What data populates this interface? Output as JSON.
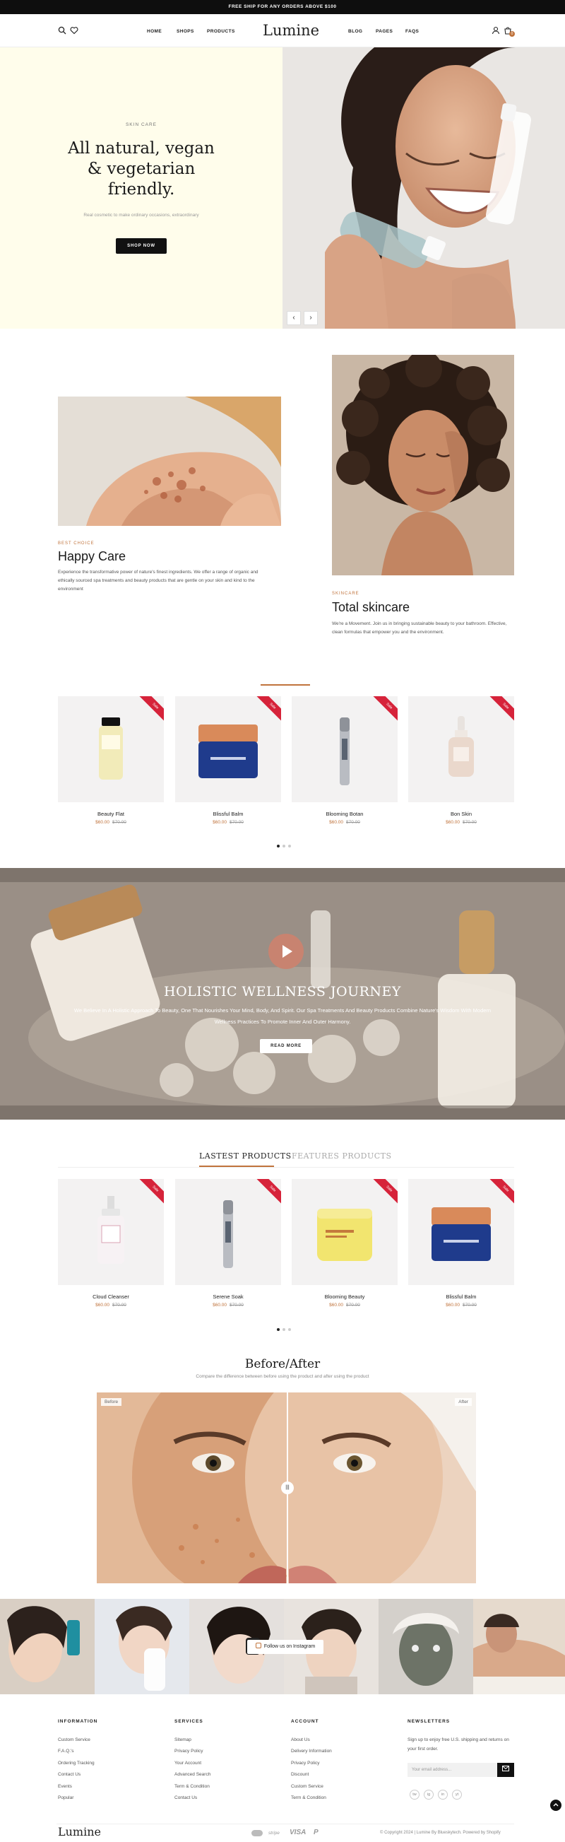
{
  "announcement": "FREE SHIP FOR ANY ORDERS ABOVE $100",
  "header": {
    "logo": "Lumine",
    "nav_left": [
      "HOME",
      "SHOPS",
      "PRODUCTS"
    ],
    "nav_right": [
      "BLOG",
      "PAGES",
      "FAQS"
    ],
    "cart_count": "0"
  },
  "hero": {
    "tag": "SKIN CARE",
    "title": "All natural, vegan & vegetarian friendly.",
    "subtitle": "Real cosmetic to make ordinary occasions, extraordinary",
    "button": "SHOP NOW",
    "prev": "‹",
    "next": "›"
  },
  "collection": {
    "left": {
      "tag": "BEST CHOICE",
      "title": "Happy Care",
      "text": "Experience the transformative power of nature's finest ingredients. We offer a range of organic and ethically sourced spa treatments and beauty products that are gentle on your skin and kind to the environment"
    },
    "right": {
      "tag": "SKINCARE",
      "title": "Total skincare",
      "text": "We're a Movement. Join us in bringing sustainable beauty to your bathroom. Effective, clean formulas that empower you and the environment."
    }
  },
  "products_row1": [
    {
      "name": "Beauty Flat",
      "price": "$60.00",
      "old_price": "$70.00",
      "badge": "Sale"
    },
    {
      "name": "Blissful Balm",
      "price": "$60.00",
      "old_price": "$70.00",
      "badge": "Sale"
    },
    {
      "name": "Blooming Botan",
      "price": "$60.00",
      "old_price": "$70.00",
      "badge": "Sale"
    },
    {
      "name": "Bon Skin",
      "price": "$60.00",
      "old_price": "$70.00",
      "badge": "Sale"
    }
  ],
  "banner": {
    "title": "HOLISTIC WELLNESS JOURNEY",
    "text": "We Believe In A Holistic Approach To Beauty, One That Nourishes Your Mind, Body, And Spirit. Our Spa Treatments And Beauty Products Combine Nature's Wisdom With Modern Wellness Practices To Promote Inner And Outer Harmony.",
    "button": "READ MORE"
  },
  "tabs": {
    "active": "LASTEST PRODUCTS",
    "inactive": "FEATURES PRODUCTS"
  },
  "products_row2": [
    {
      "name": "Cloud Cleanser",
      "price": "$60.00",
      "old_price": "$70.00",
      "badge": "Sale"
    },
    {
      "name": "Serene Soak",
      "price": "$60.00",
      "old_price": "$70.00",
      "badge": "Sale"
    },
    {
      "name": "Blooming Beauty",
      "price": "$60.00",
      "old_price": "$70.00",
      "badge": "Sale"
    },
    {
      "name": "Blissful Balm",
      "price": "$60.00",
      "old_price": "$70.00",
      "badge": "Sale"
    }
  ],
  "before_after": {
    "title": "Before/After",
    "subtitle": "Compare the difference between before using the product and after using the product",
    "before": "Before",
    "after": "After",
    "handle": "|||"
  },
  "instagram": {
    "button": "Follow us on Instagram"
  },
  "footer": {
    "information": {
      "heading": "INFORMATION",
      "links": [
        "Custom Service",
        "F.A.Q.'s",
        "Ordering Tracking",
        "Contact Us",
        "Events",
        "Popular"
      ]
    },
    "services": {
      "heading": "SERVICES",
      "links": [
        "Sitemap",
        "Privacy Policy",
        "Your Account",
        "Advanced Search",
        "Term & Condition",
        "Contact Us"
      ]
    },
    "account": {
      "heading": "ACCOUNT",
      "links": [
        "About Us",
        "Delivery Information",
        "Privacy Policy",
        "Discount",
        "Custom Service",
        "Term & Condition"
      ]
    },
    "newsletter": {
      "heading": "NEWSLETTERS",
      "text": "Sign up to enjoy free U.S. shipping and returns on your first order.",
      "placeholder": "Your email address...",
      "social": [
        "tw",
        "ig",
        "in",
        "yt"
      ]
    },
    "logo": "Lumine",
    "payments": [
      "stripe",
      "VISA",
      "P"
    ],
    "copyright": "© Copyright 2024 | Lumine By Blueskytech. Powered by Shopify"
  },
  "colors": {
    "accent": "#c0733c",
    "sale": "#d6233a",
    "hero_bg": "#fffdeb"
  }
}
